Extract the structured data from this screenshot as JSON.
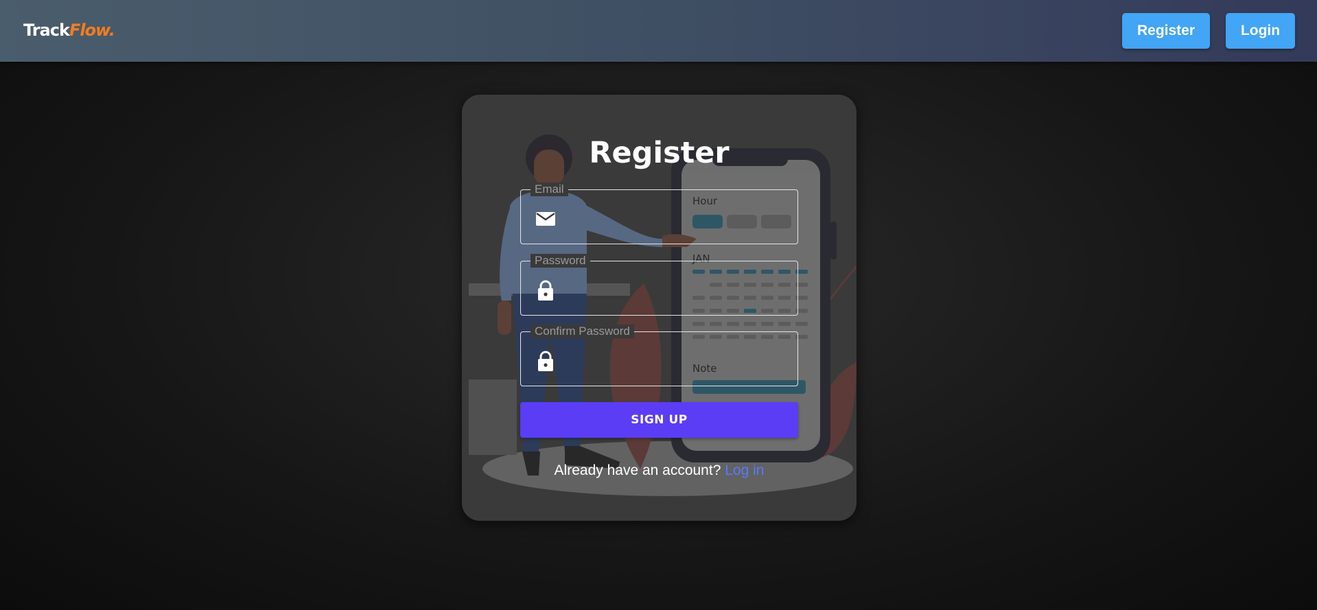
{
  "header": {
    "logo_main": "Track",
    "logo_accent": "Flow.",
    "register_label": "Register",
    "login_label": "Login"
  },
  "colors": {
    "header_start": "#4a5d6c",
    "header_end": "#343a5a",
    "nav_button": "#42a5f5",
    "logo_accent": "#f57c1f",
    "primary_button": "#5b3df5",
    "link": "#5a78ff",
    "card_background": "#3a3a3a"
  },
  "form": {
    "title": "Register",
    "fields": [
      {
        "label": "Email",
        "value": "",
        "icon": "envelope-icon"
      },
      {
        "label": "Password",
        "value": "",
        "icon": "lock-icon"
      },
      {
        "label": "Confirm Password",
        "value": "",
        "icon": "lock-icon"
      }
    ],
    "submit_label": "SIGN UP",
    "footer_text": "Already have an account?",
    "footer_link": "Log in"
  },
  "illustration": {
    "labels": [
      "Hour",
      "JAN",
      "Note"
    ]
  }
}
